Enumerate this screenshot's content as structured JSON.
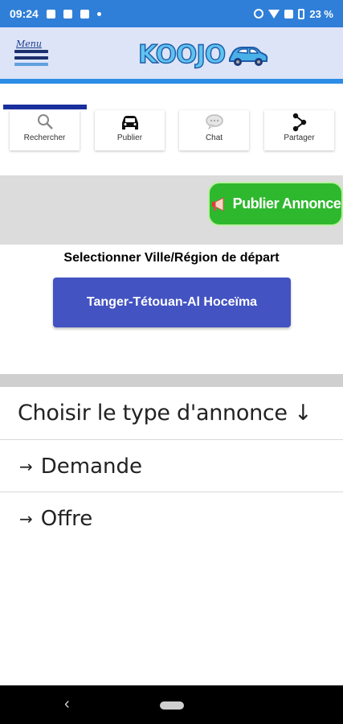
{
  "status_bar": {
    "time": "09:24",
    "battery": "23 %"
  },
  "header": {
    "menu_label": "Menu",
    "logo_text": "KOOJO"
  },
  "toolbar": [
    {
      "label": "Rechercher",
      "icon": "search-icon"
    },
    {
      "label": "Publier",
      "icon": "car-icon"
    },
    {
      "label": "Chat",
      "icon": "chat-icon"
    },
    {
      "label": "Partager",
      "icon": "share-icon"
    }
  ],
  "publish": {
    "label": "Publier Annonce",
    "icon": "megaphone-icon",
    "color": "#2eb82e"
  },
  "region": {
    "prompt": "Selectionner Ville/Région de départ",
    "selected": "Tanger-Tétouan-Al Hoceïma",
    "color": "#4353c2"
  },
  "ad_type": {
    "title": "Choisir le type d'annonce ↓",
    "options": [
      {
        "arrow": "→",
        "label": "Demande"
      },
      {
        "arrow": "→",
        "label": "Offre"
      }
    ]
  },
  "colors": {
    "status_bar": "#2f7fd8",
    "header_bg": "#dde4f7",
    "accent_line": "#2c8de6"
  }
}
